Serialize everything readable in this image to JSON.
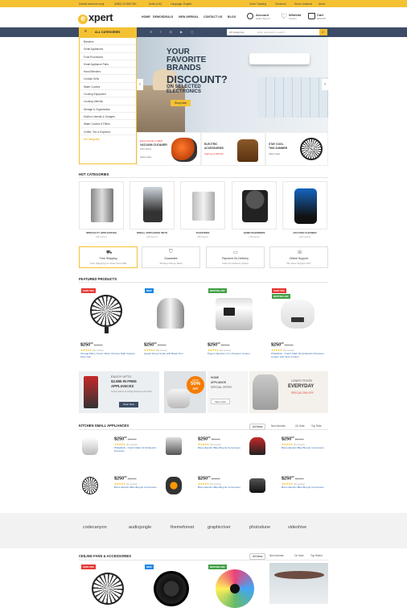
{
  "topbar": {
    "email": "Default welcome msg!",
    "phone": "(0982) 23 4567 891",
    "currency": "Dollar (US)",
    "language": "Language: English",
    "order_tracking": "Order Tracking",
    "checkout": "Checkout",
    "store_locations": "Store Locations",
    "about": "About"
  },
  "header": {
    "logo_letter": "e",
    "logo_text": "xpert",
    "nav": [
      "HOME",
      "DEMOS",
      "DEALS",
      "NEW ARRIVAL",
      "CONTACT US",
      "BLOG"
    ],
    "account_title": "Account",
    "account_sub": "Hello! Sign In",
    "wishlist_title": "Wishlist",
    "wishlist_sub": "0 items",
    "cart_title": "Cart",
    "cart_sub": "$263.00"
  },
  "navbar": {
    "all_categories": "ALL CATEGORIES",
    "search_select": "All Categories",
    "search_placeholder": "Enter keywords to search..."
  },
  "categories": [
    "Blenders",
    "Small Appliances",
    "Food Processors",
    "Small Appliance Parts",
    "Hand Blenders",
    "Contact Grills",
    "Water Coolers",
    "Cooking Equipment",
    "Cooking Utensils",
    "Storage & Organization",
    "Kitchen Utensils & Gadgets",
    "Water Coolers & Filters",
    "Coffee, Tea & Espresso",
    "All Categories"
  ],
  "hero": {
    "line1": "YOUR",
    "line2": "FAVORITE",
    "line3": "BRANDS",
    "line4": "DISCOUNT?",
    "line5": "ON SELECTED",
    "line6": "ELECTRONICS",
    "button": "Shop Now"
  },
  "subbanners": [
    {
      "kicker": "EXCLUSIVE CYBER",
      "title": "VACUUM CLEANER",
      "sub": "MVC-8221",
      "link": "View more"
    },
    {
      "kicker": "ELECTRIC",
      "title": "ACCESSORIES",
      "sub": "Starting at $65.00"
    },
    {
      "kicker": "STAY COOL",
      "title": "THIS SUMMER",
      "link": "View more"
    }
  ],
  "hot": {
    "title": "HOT CATEGORIES",
    "items": [
      {
        "name": "SPECIALTY APPLIANCES",
        "count": "(65 items)"
      },
      {
        "name": "SMALL APPLIANCE SETS",
        "count": "(25 items)"
      },
      {
        "name": "TOASTERS",
        "count": "(85 items)"
      },
      {
        "name": "HAND BLENDERS",
        "count": "(15 items)"
      },
      {
        "name": "VACUUM CLEANER",
        "count": "(115 items)"
      }
    ]
  },
  "features": [
    {
      "title": "Free Shipping",
      "sub": "Free Shipping On Order Over $99"
    },
    {
      "title": "Guarantee",
      "sub": "30 Days Money Back"
    },
    {
      "title": "Payment On Delivery",
      "sub": "Cash On Delivery Option"
    },
    {
      "title": "Online Support",
      "sub": "We Have Support 24/7"
    }
  ],
  "featured": {
    "title": "FEATURED PRODUCTS",
    "items": [
      {
        "badge": "SAVE 50%",
        "price": "$250",
        "cents": "00",
        "old": "$500.00",
        "reviews": "(61 review)",
        "name": "Omega Mfrce Ommc 40cm Chrome High Velocity Floor Fan"
      },
      {
        "badge": "NEW",
        "price": "$250",
        "cents": "00",
        "old": "$500.00",
        "reviews": "(61 review)",
        "name": "Quadc Dome Kettle with Black Trim"
      },
      {
        "badge": "BESTSELLER",
        "price": "$250",
        "cents": "00",
        "old": "$500.00",
        "reviews": "(61 review)",
        "name": "Pigeon Spectra 1.5 L Pressure Cooker"
      },
      {
        "badge": "SAVE 50%",
        "badge2": "BESTSELLER",
        "price": "$250",
        "cents": "00",
        "old": "$500.00",
        "reviews": "(61 review)",
        "name": "PhilipFlick - Chef's Mark 50 Qt Electric Pressure Cooker with Slow Cooker"
      }
    ]
  },
  "promos": [
    {
      "l1": "ENJOY UPTO",
      "l2": "$2.685 IN FREE",
      "l3": "APPLIANCES",
      "sub": "Lorem ipsum is simply dummy text of the",
      "btn": "Shop Now"
    },
    {
      "l1": "UPTO",
      "l2": "50%",
      "l3": "OFF"
    },
    {
      "l1": "HOME",
      "l2": "APPLIANCE",
      "l3": "SPECIAL OFFER",
      "btn": "View more"
    },
    {
      "l1": "LOWEST PRICES",
      "l2": "EVERYDAY",
      "l3": "SPECIAL 25% OFF"
    }
  ],
  "kitchen": {
    "title": "KITCHEN SMALL APPLIANCES",
    "tabs": [
      "All News",
      "New Arrivals",
      "On Sale",
      "Top Rate"
    ],
    "items": [
      {
        "price": "$250",
        "cents": "00",
        "old": "$500.00",
        "reviews": "(61 review)",
        "name": "PhilipFlick - Chef's Mark 10 Qt Electric Pressure..."
      },
      {
        "price": "$250",
        "cents": "00",
        "old": "$500.00",
        "reviews": "(61 review)",
        "name": "Bixne Electric Bike Bicycle Conversion"
      },
      {
        "price": "$250",
        "cents": "00",
        "old": "$500.00",
        "reviews": "(61 review)",
        "name": "Bixne Electric Bike Bicycle Conversion"
      },
      {
        "price": "$250",
        "cents": "00",
        "old": "$500.00",
        "reviews": "(61 review)",
        "name": "Bixne Electric Bike Bicycle Conversion"
      },
      {
        "price": "$250",
        "cents": "00",
        "old": "$500.00",
        "reviews": "(61 review)",
        "name": "Bixne Electric Bike Bicycle Conversion"
      },
      {
        "price": "$250",
        "cents": "00",
        "old": "$500.00",
        "reviews": "(61 review)",
        "name": "Bixne Electric Bike Bicycle Conversion"
      }
    ]
  },
  "brands": [
    "codecanyon",
    "audiojungle",
    "themeforest",
    "graphicriver",
    "photodune",
    "videohive"
  ],
  "ceiling": {
    "title": "CEILING FANS & ACCESSORIES",
    "tabs": [
      "All News",
      "New Arrivals",
      "On Sale",
      "Top Rated"
    ],
    "badges": [
      "SAVE 50%",
      "NEW",
      "BESTSELLER"
    ]
  },
  "colors": {
    "accent": "#f4c133",
    "navbar": "#3d4c66",
    "badge_sale": "#e53935",
    "badge_new": "#1e88e5",
    "badge_best": "#43a047"
  }
}
